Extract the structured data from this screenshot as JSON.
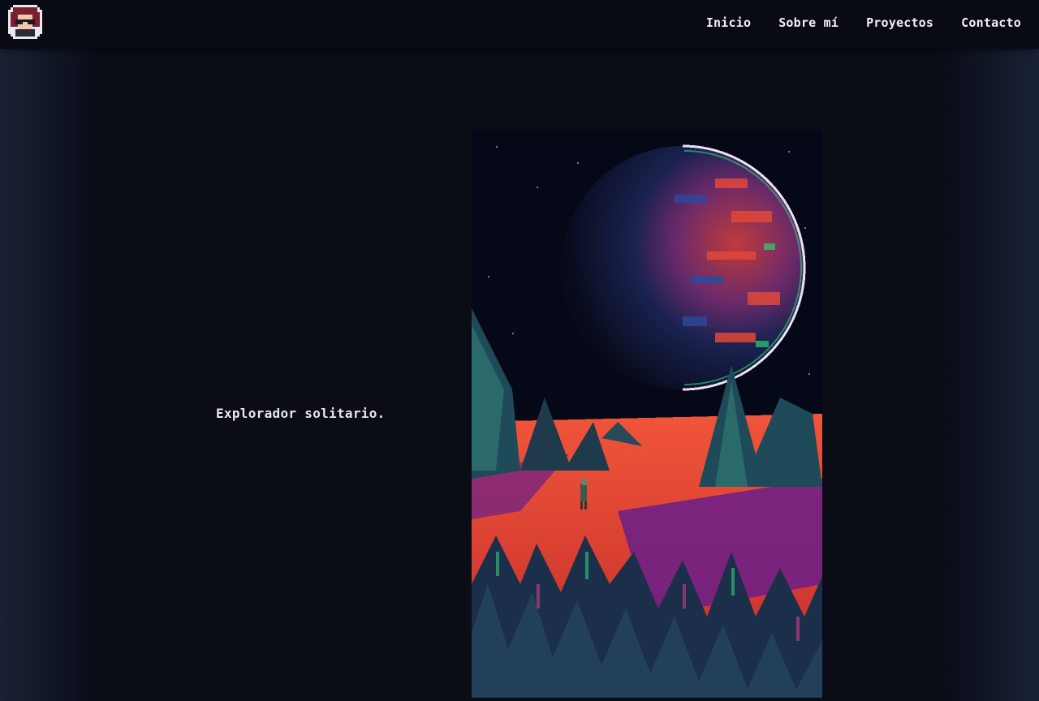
{
  "header": {
    "logo_icon": "pixel-avatar-icon",
    "nav": [
      {
        "label": "Inicio"
      },
      {
        "label": "Sobre mí"
      },
      {
        "label": "Proyectos"
      },
      {
        "label": "Contacto"
      }
    ]
  },
  "main": {
    "caption": "Explorador solitario.",
    "artwork_icon": "pixel-art-planet-landscape"
  },
  "colors": {
    "background": "#0a0c16",
    "header": "#080a14",
    "text": "#e6e6ea",
    "accent_red": "#e8442e",
    "accent_purple": "#6a1f8a",
    "accent_teal": "#1f6a6a"
  }
}
